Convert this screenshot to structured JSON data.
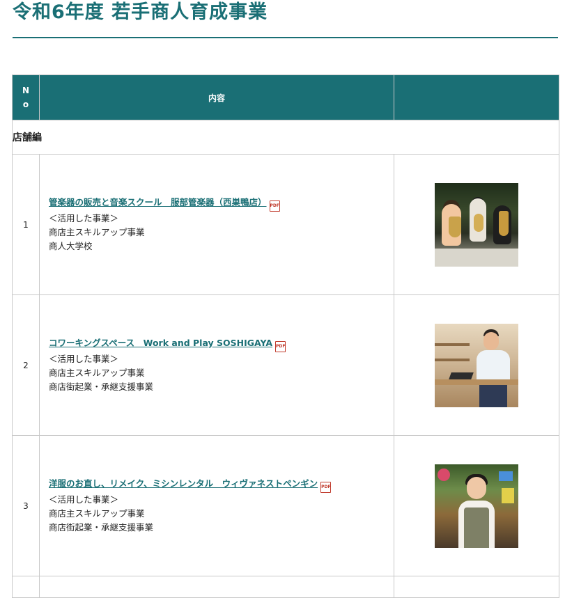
{
  "page": {
    "title": "令和6年度 若手商人育成事業"
  },
  "table": {
    "headers": {
      "no": [
        "N",
        "o"
      ],
      "content": "内容",
      "image": ""
    },
    "section_label": "店舗編",
    "rows": [
      {
        "no": "1",
        "link_text": "管楽器の販売と音楽スクール　服部管楽器（西巣鴨店）",
        "pdf_label": "PDF",
        "lines": [
          "＜活用した事業＞",
          "商店主スキルアップ事業",
          "商人大学校"
        ]
      },
      {
        "no": "2",
        "link_text": "コワーキングスペース　Work and Play SOSHIGAYA",
        "pdf_label": "PDF",
        "lines": [
          "＜活用した事業＞",
          "商店主スキルアップ事業",
          "商店街起業・承継支援事業"
        ]
      },
      {
        "no": "3",
        "link_text": "洋服のお直し、リメイク、ミシンレンタル　ウィヴァネストペンギン",
        "pdf_label": "PDF",
        "lines": [
          "＜活用した事業＞",
          "商店主スキルアップ事業",
          "商店街起業・承継支援事業"
        ]
      }
    ]
  },
  "colors": {
    "accent": "#1a6f75",
    "pdf_red": "#c0392b",
    "border": "#c8c8c8"
  }
}
